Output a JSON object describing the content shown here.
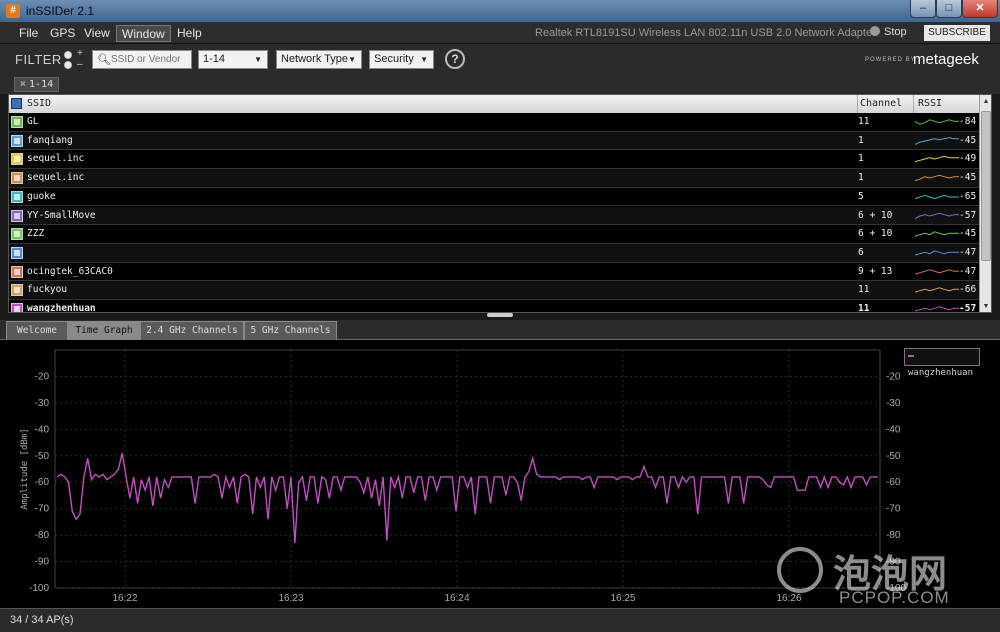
{
  "window": {
    "title": "inSSIDer 2.1",
    "icon": "hash-icon"
  },
  "menu": {
    "items": [
      {
        "label": "File"
      },
      {
        "label": "GPS"
      },
      {
        "label": "View"
      },
      {
        "label": "Window",
        "active": true
      },
      {
        "label": "Help"
      }
    ],
    "adapter": "Realtek RTL8191SU Wireless LAN 802.11n USB 2.0 Network Adapter",
    "stop_label": "Stop",
    "subscribe_label": "SUBSCRIBE"
  },
  "filter": {
    "label": "FILTER",
    "search_placeholder": "SSID or Vendor",
    "channel_value": "1-14",
    "network_type_value": "Network Type",
    "security_value": "Security",
    "help_label": "?",
    "powered_by": "POWERED BY",
    "brand": "metageek",
    "active_tag": "1-14"
  },
  "table": {
    "columns": {
      "ssid": "SSID",
      "channel": "Channel",
      "rssi": "RSSI"
    },
    "rows": [
      {
        "ssid": "GL",
        "channel": "11",
        "rssi": "-84",
        "color": "#5fbf3f",
        "spark": [
          -84,
          -86,
          -85,
          -83,
          -84,
          -85,
          -84,
          -83,
          -84,
          -84
        ]
      },
      {
        "ssid": "fanqiang",
        "channel": "1",
        "rssi": "-45",
        "color": "#4fa3e0",
        "spark": [
          -50,
          -48,
          -47,
          -46,
          -45,
          -46,
          -45,
          -44,
          -45,
          -45
        ]
      },
      {
        "ssid": "sequel.inc",
        "channel": "1",
        "rssi": "-49",
        "color": "#e8d23a",
        "spark": [
          -52,
          -51,
          -50,
          -49,
          -50,
          -49,
          -48,
          -49,
          -49,
          -49
        ]
      },
      {
        "ssid": "sequel.inc",
        "channel": "1",
        "rssi": "-45",
        "color": "#e08a3a",
        "spark": [
          -48,
          -47,
          -45,
          -46,
          -45,
          -44,
          -45,
          -46,
          -45,
          -45
        ]
      },
      {
        "ssid": "guoke",
        "channel": "5",
        "rssi": "-65",
        "color": "#3fb7c8",
        "spark": [
          -66,
          -65,
          -64,
          -65,
          -66,
          -65,
          -64,
          -65,
          -65,
          -65
        ]
      },
      {
        "ssid": "YY-SmallMove",
        "channel": "6 + 10",
        "rssi": "-57",
        "color": "#8a5fd0",
        "spark": [
          -60,
          -58,
          -57,
          -58,
          -57,
          -56,
          -57,
          -58,
          -57,
          -57
        ]
      },
      {
        "ssid": "ZZZ",
        "channel": "6 + 10",
        "rssi": "-45",
        "color": "#6fcf4f",
        "spark": [
          -47,
          -46,
          -45,
          -46,
          -44,
          -45,
          -46,
          -45,
          -45,
          -45
        ]
      },
      {
        "ssid": "",
        "channel": "6",
        "rssi": "-47",
        "color": "#4f8fe0",
        "spark": [
          -49,
          -48,
          -47,
          -48,
          -46,
          -47,
          -48,
          -47,
          -47,
          -47
        ]
      },
      {
        "ssid": "ocingtek_63CAC0",
        "channel": "9 + 13",
        "rssi": "-47",
        "color": "#e07050",
        "spark": [
          -49,
          -48,
          -47,
          -46,
          -47,
          -48,
          -47,
          -46,
          -47,
          -47
        ]
      },
      {
        "ssid": "fuckyou",
        "channel": "11",
        "rssi": "-66",
        "color": "#e0a050",
        "spark": [
          -68,
          -67,
          -66,
          -67,
          -66,
          -65,
          -66,
          -67,
          -66,
          -66
        ]
      },
      {
        "ssid": "wangzhenhuan",
        "channel": "11",
        "rssi": "-57",
        "color": "#c050c0",
        "bold": true,
        "checked": true,
        "spark": [
          -59,
          -58,
          -57,
          -58,
          -57,
          -56,
          -57,
          -58,
          -57,
          -57
        ]
      }
    ]
  },
  "tabs": [
    {
      "label": "Welcome"
    },
    {
      "label": "Time Graph",
      "active": true
    },
    {
      "label": "2.4 GHz Channels"
    },
    {
      "label": "5 GHz Channels"
    }
  ],
  "status": {
    "ap_count": "34 / 34 AP(s)"
  },
  "watermark": {
    "cn": "泡泡网",
    "en": "PCPOP.COM"
  },
  "chart_data": {
    "type": "line",
    "ylabel": "Amplitude [dBm]",
    "ylim": [
      -100,
      -10
    ],
    "yticks": [
      -20,
      -30,
      -40,
      -50,
      -60,
      -70,
      -80,
      -90,
      -100
    ],
    "xticks": [
      "16:22",
      "16:23",
      "16:24",
      "16:25",
      "16:26"
    ],
    "grid": true,
    "legend_position": "top-right",
    "series": [
      {
        "name": "wangzhenhuan",
        "color": "#c050c0",
        "values": [
          -58,
          -57,
          -58,
          -60,
          -71,
          -74,
          -72,
          -58,
          -51,
          -59,
          -57,
          -58,
          -57,
          -59,
          -58,
          -57,
          -55,
          -49,
          -58,
          -66,
          -58,
          -68,
          -59,
          -63,
          -58,
          -69,
          -58,
          -66,
          -59,
          -62,
          -58,
          -58,
          -58,
          -58,
          -58,
          -58,
          -68,
          -58,
          -58,
          -58,
          -58,
          -57,
          -58,
          -66,
          -58,
          -62,
          -58,
          -68,
          -58,
          -57,
          -58,
          -72,
          -58,
          -62,
          -58,
          -74,
          -58,
          -63,
          -58,
          -58,
          -70,
          -58,
          -83,
          -60,
          -58,
          -67,
          -58,
          -58,
          -68,
          -58,
          -59,
          -66,
          -58,
          -58,
          -63,
          -58,
          -58,
          -58,
          -58,
          -60,
          -64,
          -58,
          -66,
          -59,
          -69,
          -58,
          -82,
          -58,
          -62,
          -58,
          -66,
          -58,
          -58,
          -64,
          -58,
          -58,
          -67,
          -58,
          -58,
          -63,
          -58,
          -58,
          -58,
          -58,
          -71,
          -58,
          -58,
          -62,
          -58,
          -72,
          -58,
          -58,
          -58,
          -68,
          -58,
          -58,
          -58,
          -65,
          -58,
          -58,
          -60,
          -67,
          -58,
          -56,
          -51,
          -57,
          -58,
          -58,
          -58,
          -58,
          -58,
          -59,
          -58,
          -58,
          -58,
          -58,
          -58,
          -59,
          -58,
          -58,
          -62,
          -58,
          -58,
          -58,
          -58,
          -58,
          -59,
          -58,
          -58,
          -58,
          -59,
          -58,
          -58,
          -54,
          -58,
          -58,
          -62,
          -58,
          -58,
          -68,
          -58,
          -58,
          -62,
          -58,
          -60,
          -58,
          -58,
          -72,
          -58,
          -58,
          -58,
          -58,
          -58,
          -58,
          -58,
          -68,
          -58,
          -58,
          -58,
          -68,
          -58,
          -58,
          -58,
          -58,
          -59,
          -61,
          -62,
          -58,
          -58,
          -58,
          -58,
          -58,
          -58,
          -63,
          -63,
          -63,
          -58,
          -58,
          -58,
          -62,
          -58,
          -62,
          -58,
          -58,
          -60,
          -61,
          -58,
          -62,
          -58,
          -58,
          -58,
          -61,
          -58,
          -58,
          -58
        ]
      }
    ]
  }
}
